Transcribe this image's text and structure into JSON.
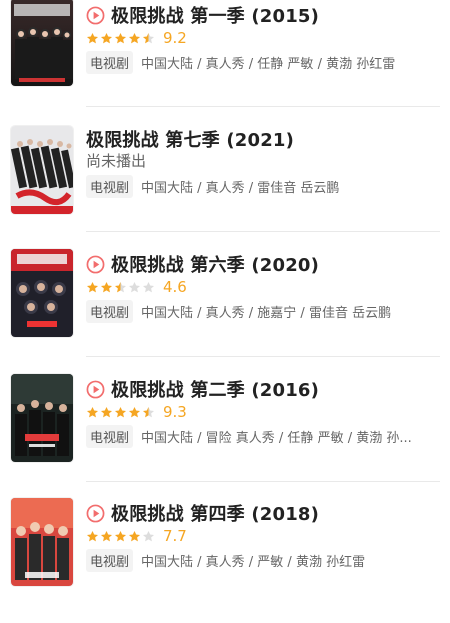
{
  "colors": {
    "accent": "#f5a623",
    "play": "#f26d6d",
    "star_empty": "#dddddd"
  },
  "items": [
    {
      "title": "极限挑战 第一季 (2015)",
      "has_play": true,
      "rating_stars": 4.5,
      "score": "9.2",
      "status": "",
      "tag": "电视剧",
      "meta": "中国大陆 / 真人秀 / 任静 严敏 / 黄渤 孙红雷",
      "poster_icon": "poster-image"
    },
    {
      "title": "极限挑战 第七季 (2021)",
      "has_play": false,
      "rating_stars": null,
      "score": "",
      "status": "尚未播出",
      "tag": "电视剧",
      "meta": "中国大陆 / 真人秀 / 雷佳音 岳云鹏",
      "poster_icon": "poster-image"
    },
    {
      "title": "极限挑战 第六季 (2020)",
      "has_play": true,
      "rating_stars": 2.5,
      "score": "4.6",
      "status": "",
      "tag": "电视剧",
      "meta": "中国大陆 / 真人秀 / 施嘉宁 / 雷佳音 岳云鹏",
      "poster_icon": "poster-image"
    },
    {
      "title": "极限挑战 第二季 (2016)",
      "has_play": true,
      "rating_stars": 4.5,
      "score": "9.3",
      "status": "",
      "tag": "电视剧",
      "meta": "中国大陆 / 冒险 真人秀 / 任静 严敏 / 黄渤 孙...",
      "poster_icon": "poster-image"
    },
    {
      "title": "极限挑战 第四季 (2018)",
      "has_play": true,
      "rating_stars": 4.0,
      "score": "7.7",
      "status": "",
      "tag": "电视剧",
      "meta": "中国大陆 / 真人秀 / 严敏 / 黄渤 孙红雷",
      "poster_icon": "poster-image"
    }
  ]
}
